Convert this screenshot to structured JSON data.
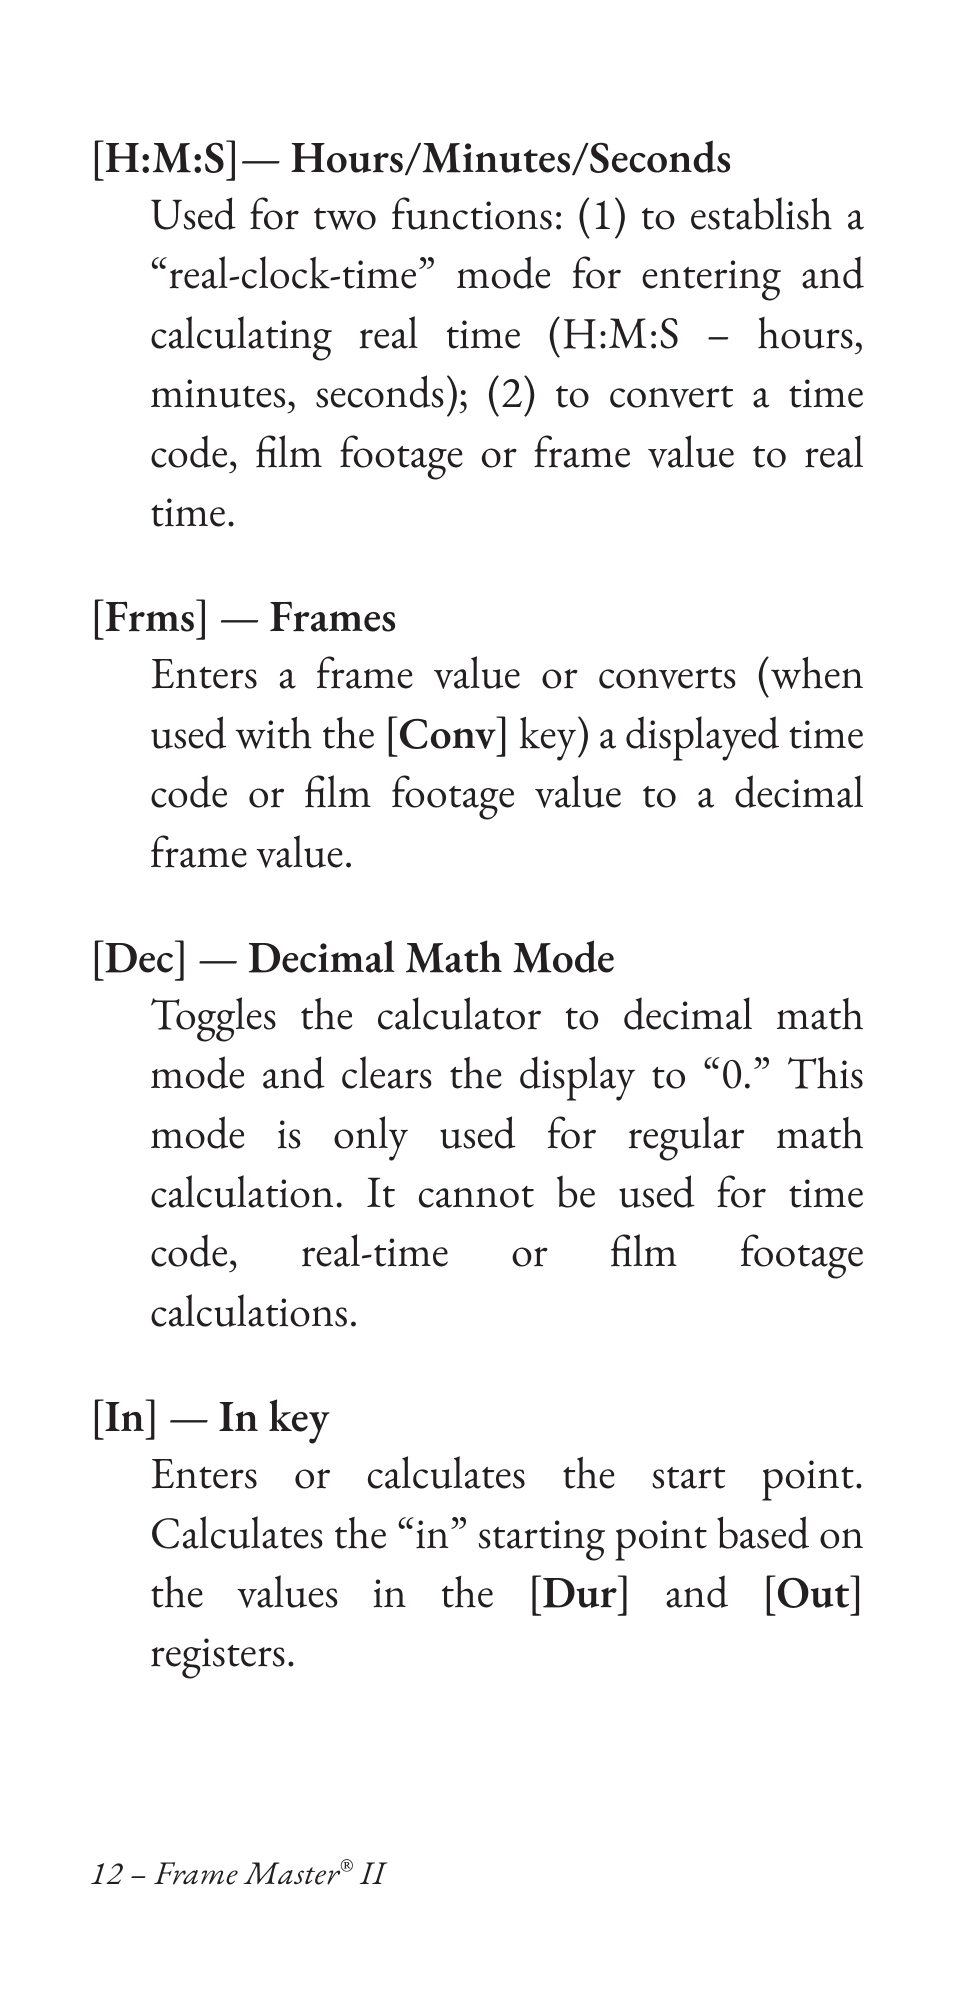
{
  "entries": [
    {
      "key": "H:M:S",
      "dash": "—",
      "title": "Hours/Minutes/Seconds",
      "body_parts": [
        {
          "t": "Used for two functions: (1) to estab­lish a “real-clock-time” mode for entering and calculating real time (H:M:S – hours, minutes, seconds); (2) to convert a time code, film footage or frame value to real time."
        }
      ]
    },
    {
      "key": "Frms",
      "dash": "—",
      "title": "Frames",
      "body_parts": [
        {
          "t": "Enters a frame value or converts (when used with the ["
        },
        {
          "t": "Conv",
          "bold": true
        },
        {
          "t": "] key) a displayed time code or film footage value to a decimal frame value."
        }
      ]
    },
    {
      "key": "Dec",
      "dash": "—",
      "title": "Decimal Math Mode",
      "body_parts": [
        {
          "t": "Toggles the calculator to decimal math mode and clears the display to “0.” This mode is only used for reg­ular math calculation. It cannot be used for time code, real-time or film footage calculations."
        }
      ]
    },
    {
      "key": "In",
      "dash": "—",
      "title": "In key",
      "body_parts": [
        {
          "t": "Enters or calculates the start point. Calculates the “in” starting point based on the values in the ["
        },
        {
          "t": "Dur",
          "bold": true
        },
        {
          "t": "] and ["
        },
        {
          "t": "Out",
          "bold": true
        },
        {
          "t": "] registers."
        }
      ]
    }
  ],
  "footer": {
    "page_num": "12",
    "sep": " – ",
    "product_pre": "Frame Master",
    "reg": "®",
    "product_post": " II"
  }
}
